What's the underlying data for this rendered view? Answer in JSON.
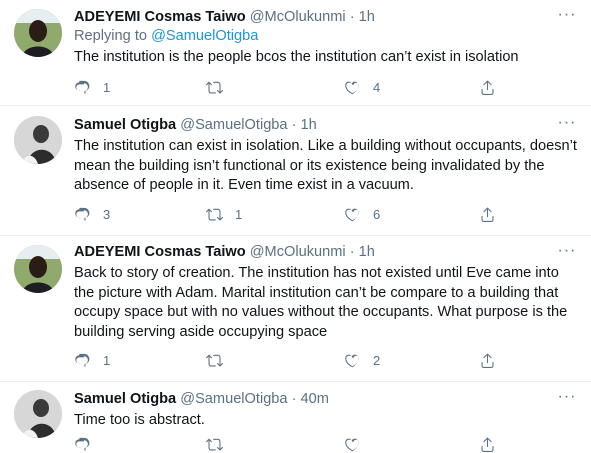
{
  "tweets": [
    {
      "name": "ADEYEMI Cosmas Taiwo",
      "handle": "@McOlukunmi",
      "time": "1h",
      "replying_label": "Replying to",
      "replying_handle": "@SamuelOtigba",
      "text": "The institution is the people bcos the institution can’t exist in isolation",
      "replies": "1",
      "retweets": "",
      "likes": "4"
    },
    {
      "name": "Samuel Otigba",
      "handle": "@SamuelOtigba",
      "time": "1h",
      "text": "The institution can exist in isolation. Like a building without occupants, doesn’t mean the building isn’t functional or its existence being invalidated by the absence of people in it. Even time exist in a vacuum.",
      "replies": "3",
      "retweets": "1",
      "likes": "6"
    },
    {
      "name": "ADEYEMI Cosmas Taiwo",
      "handle": "@McOlukunmi",
      "time": "1h",
      "text": "Back to story of creation. The institution has not existed until Eve came into the picture with Adam. Marital institution can’t be compare to a building that occupy space but with no values without the occupants.  What purpose is the building serving aside occupying space",
      "replies": "1",
      "retweets": "",
      "likes": "2"
    },
    {
      "name": "Samuel Otigba",
      "handle": "@SamuelOtigba",
      "time": "40m",
      "text": "Time too is abstract.",
      "replies": "",
      "retweets": "",
      "likes": ""
    }
  ],
  "separator": "·",
  "more_glyph": "···",
  "icons": {
    "reply": "reply-icon",
    "retweet": "retweet-icon",
    "like": "heart-icon",
    "share": "share-icon",
    "more": "more-icon"
  },
  "colors": {
    "text": "#0f1419",
    "secondary": "#5b7083",
    "link": "#1b95e0",
    "border": "#e6ecf0"
  }
}
